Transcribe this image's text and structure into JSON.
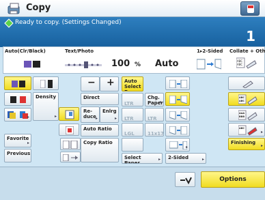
{
  "header": {
    "title": "Copy"
  },
  "status": {
    "message": "Ready to copy. (Settings Changed)",
    "copies": "1"
  },
  "settings": {
    "color_label": "Auto(Clr/Black)",
    "type_label": "Text/Photo",
    "zoom_value": "100",
    "zoom_unit": "%",
    "paper_value": "Auto",
    "sided_label": "1▸2-Sided",
    "collate_label": "Collate + Other"
  },
  "grid": {
    "density": "Density",
    "direct": "Direct",
    "reduce": "Re-\nduce",
    "enlarge": "Enlrg",
    "auto_select_paper": "Auto Select Paper",
    "chg_paper": "Chg. Paper",
    "auto_ratio": "Auto Ratio",
    "copy_ratio": "Copy Ratio",
    "favorite_settings": "Favorite Settings",
    "previous_settings": "Previous Settings",
    "select_paper": "Select Paper",
    "two_sided": "2-Sided",
    "finishing": "Finishing",
    "minus": "−",
    "plus": "+",
    "ltr": "LTR",
    "ltrr": "LTR",
    "lgl": "LGL",
    "size_11x17": "11x17",
    "ltrr_chg": "LTR",
    "ltrr_b": "LTR"
  },
  "footer": {
    "options_label": "Options"
  },
  "colors": {
    "accent": "#f1dc20",
    "status_bg": "#17609e"
  }
}
